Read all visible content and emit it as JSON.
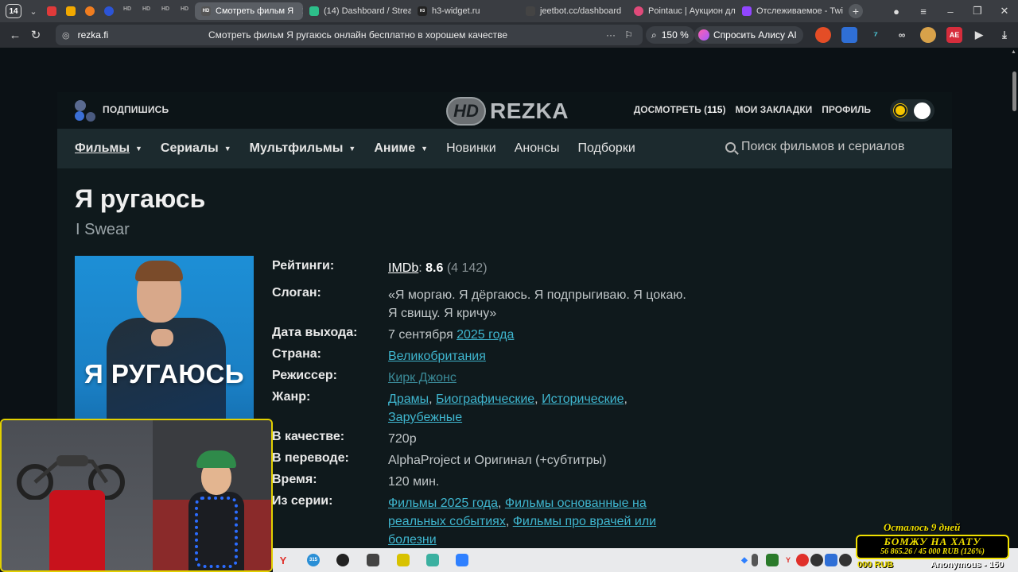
{
  "browser": {
    "tab_count": "14",
    "tabs": [
      {
        "label": "Смотреть фильм Я",
        "active": true
      },
      {
        "label": "(14) Dashboard / Strea"
      },
      {
        "label": "h3-widget.ru"
      },
      {
        "label": "jeetbot.cc/dashboard"
      },
      {
        "label": "Pointauc | Аукцион дл"
      },
      {
        "label": "Отслеживаемое - Twi"
      }
    ],
    "domain": "rezka.fi",
    "page_title": "Смотреть фильм Я ругаюсь онлайн бесплатно в хорошем качестве",
    "zoom": "150 %",
    "alice": "Спросить Алису AI",
    "ext_badge": "AE"
  },
  "site": {
    "subscribe": "ПОДПИШИСЬ",
    "brand_hd": "HD",
    "brand_name": "REZKA",
    "watch_later": "ДОСМОТРЕТЬ (",
    "watch_count": "115",
    "watch_close": ")",
    "bookmarks": "МОИ ЗАКЛАДКИ",
    "profile": "ПРОФИЛЬ",
    "menu": [
      "Фильмы",
      "Сериалы",
      "Мультфильмы",
      "Аниме",
      "Новинки",
      "Анонсы",
      "Подборки"
    ],
    "search_placeholder": "Поиск фильмов и сериалов"
  },
  "movie": {
    "title": "Я ругаюсь",
    "original_title": "I Swear",
    "poster_text": "Я РУГАЮСЬ",
    "labels": {
      "ratings": "Рейтинги:",
      "slogan": "Слоган:",
      "release": "Дата выхода:",
      "country": "Страна:",
      "director": "Режиссер:",
      "genre": "Жанр:",
      "quality": "В качестве:",
      "translation": "В переводе:",
      "time": "Время:",
      "series": "Из серии:"
    },
    "imdb_label": "IMDb",
    "imdb_rating": "8.6",
    "imdb_votes": "(4 142)",
    "slogan": "«Я моргаю. Я дёргаюсь. Я подпрыгиваю. Я цокаю. Я свищу. Я кричу»",
    "release_day": "7 сентября",
    "release_year": "2025 года",
    "country": "Великобритания",
    "director": "Кирк Джонс",
    "genres": [
      "Драмы",
      "Биографические",
      "Исторические",
      "Зарубежные"
    ],
    "quality": "720p",
    "translation": "AlphaProject и Оригинал (+субтитры)",
    "duration": "120 мин.",
    "series": [
      "Фильмы 2025 года",
      "Фильмы основанные на реальных событиях",
      "Фильмы про врачей или болезни"
    ]
  },
  "overlay": {
    "days_left": "Осталось 9 дней",
    "goal_title": "БОМЖУ НА ХАТУ",
    "goal_progress": "56 865.26 / 45 000 RUB (126%)",
    "ticker_left": "000 RUB",
    "ticker_right": "Anonymous - 150",
    "taskbar_badge": "315"
  },
  "colors": {
    "accent_link": "#3fb6cf",
    "goal_yellow": "#f0e000",
    "page_bg": "#0b1115"
  }
}
